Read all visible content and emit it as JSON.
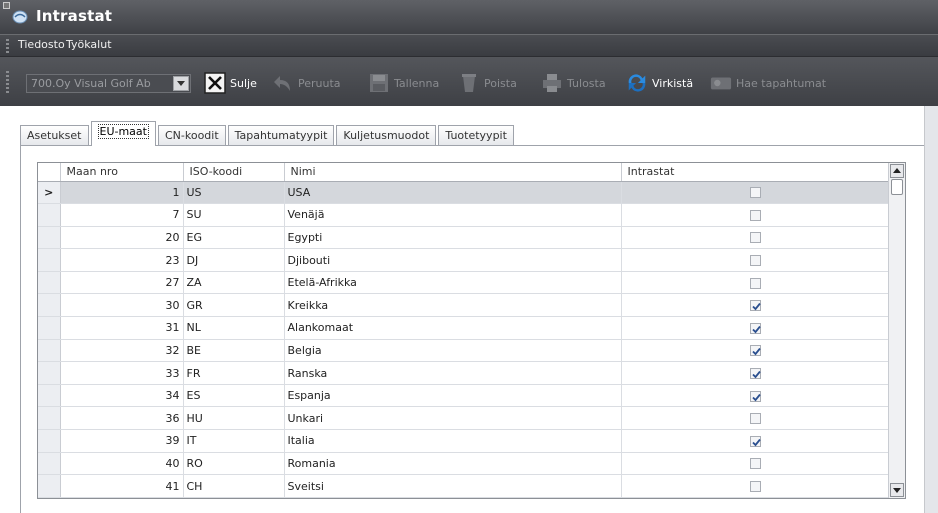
{
  "window": {
    "title": "Intrastat"
  },
  "menu": {
    "items": [
      "Tiedosto",
      "Työkalut"
    ]
  },
  "toolbar": {
    "company": "700.Oy Visual Golf Ab",
    "buttons": [
      {
        "label": "Sulje",
        "icon": "close-x-icon",
        "enabled": true
      },
      {
        "label": "Peruuta",
        "icon": "undo-arrow-icon",
        "enabled": false
      },
      {
        "label": "Tallenna",
        "icon": "save-disk-icon",
        "enabled": false
      },
      {
        "label": "Poista",
        "icon": "delete-bin-icon",
        "enabled": false
      },
      {
        "label": "Tulosta",
        "icon": "printer-icon",
        "enabled": false
      },
      {
        "label": "Virkistä",
        "icon": "refresh-icon",
        "enabled": true
      },
      {
        "label": "Hae tapahtumat",
        "icon": "fetch-events-icon",
        "enabled": false
      }
    ]
  },
  "tabs": [
    "Asetukset",
    "EU-maat",
    "CN-koodit",
    "Tapahtumatyypit",
    "Kuljetusmuodot",
    "Tuotetyypit"
  ],
  "active_tab": "EU-maat",
  "grid": {
    "columns": [
      "Maan nro",
      "ISO-koodi",
      "Nimi",
      "Intrastat"
    ],
    "current_row_marker": ">",
    "rows": [
      {
        "nro": "1",
        "iso": "US",
        "nimi": "USA",
        "intrastat": false
      },
      {
        "nro": "7",
        "iso": "SU",
        "nimi": "Venäjä",
        "intrastat": false
      },
      {
        "nro": "20",
        "iso": "EG",
        "nimi": "Egypti",
        "intrastat": false
      },
      {
        "nro": "23",
        "iso": "DJ",
        "nimi": "Djibouti",
        "intrastat": false
      },
      {
        "nro": "27",
        "iso": "ZA",
        "nimi": "Etelä-Afrikka",
        "intrastat": false
      },
      {
        "nro": "30",
        "iso": "GR",
        "nimi": "Kreikka",
        "intrastat": true
      },
      {
        "nro": "31",
        "iso": "NL",
        "nimi": "Alankomaat",
        "intrastat": true
      },
      {
        "nro": "32",
        "iso": "BE",
        "nimi": "Belgia",
        "intrastat": true
      },
      {
        "nro": "33",
        "iso": "FR",
        "nimi": "Ranska",
        "intrastat": true
      },
      {
        "nro": "34",
        "iso": "ES",
        "nimi": "Espanja",
        "intrastat": true
      },
      {
        "nro": "36",
        "iso": "HU",
        "nimi": "Unkari",
        "intrastat": false
      },
      {
        "nro": "39",
        "iso": "IT",
        "nimi": "Italia",
        "intrastat": true
      },
      {
        "nro": "40",
        "iso": "RO",
        "nimi": "Romania",
        "intrastat": false
      },
      {
        "nro": "41",
        "iso": "CH",
        "nimi": "Sveitsi",
        "intrastat": false
      }
    ]
  }
}
